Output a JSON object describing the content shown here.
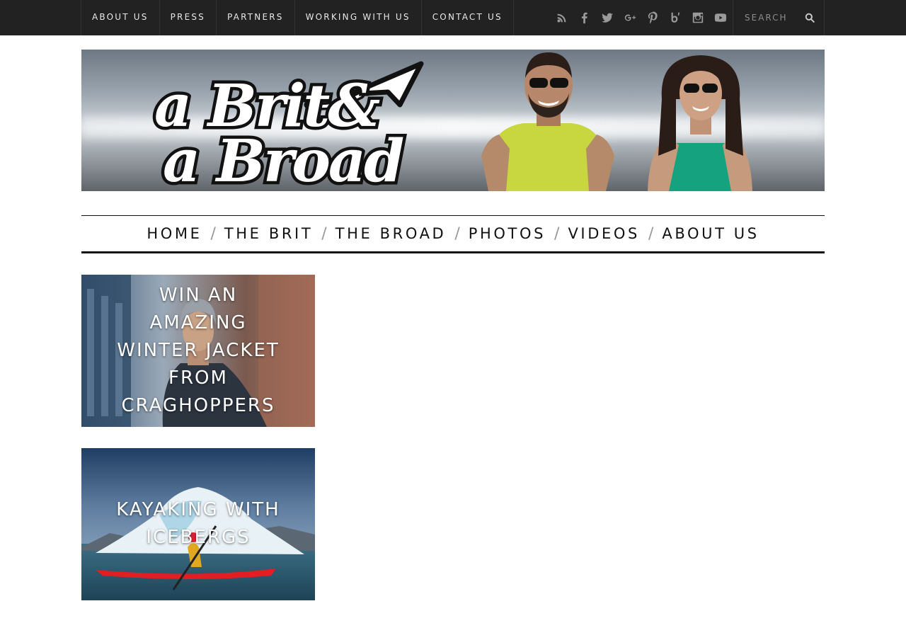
{
  "top_nav": {
    "items": [
      {
        "label": "ABOUT US"
      },
      {
        "label": "PRESS"
      },
      {
        "label": "PARTNERS"
      },
      {
        "label": "WORKING WITH US"
      },
      {
        "label": "CONTACT US"
      }
    ]
  },
  "social_icons": [
    "rss-icon",
    "facebook-icon",
    "twitter-icon",
    "google-plus-icon",
    "pinterest-icon",
    "bloglovin-icon",
    "instagram-icon",
    "youtube-icon"
  ],
  "search": {
    "placeholder": "SEARCH"
  },
  "banner": {
    "logo_text_line1": "a Brit&",
    "logo_text_line2": "a Broad"
  },
  "main_nav": {
    "items": [
      {
        "label": "HOME"
      },
      {
        "label": "THE BRIT"
      },
      {
        "label": "THE BROAD"
      },
      {
        "label": "PHOTOS"
      },
      {
        "label": "VIDEOS"
      },
      {
        "label": "ABOUT US"
      }
    ],
    "separator": "/"
  },
  "posts": [
    {
      "title": "WIN AN AMAZING WINTER JACKET FROM CRAGHOPPERS"
    },
    {
      "title": "KAYAKING WITH ICEBERGS"
    }
  ],
  "colors": {
    "topbar": "#222222",
    "nav_text": "#111111",
    "separator": "#999999"
  }
}
